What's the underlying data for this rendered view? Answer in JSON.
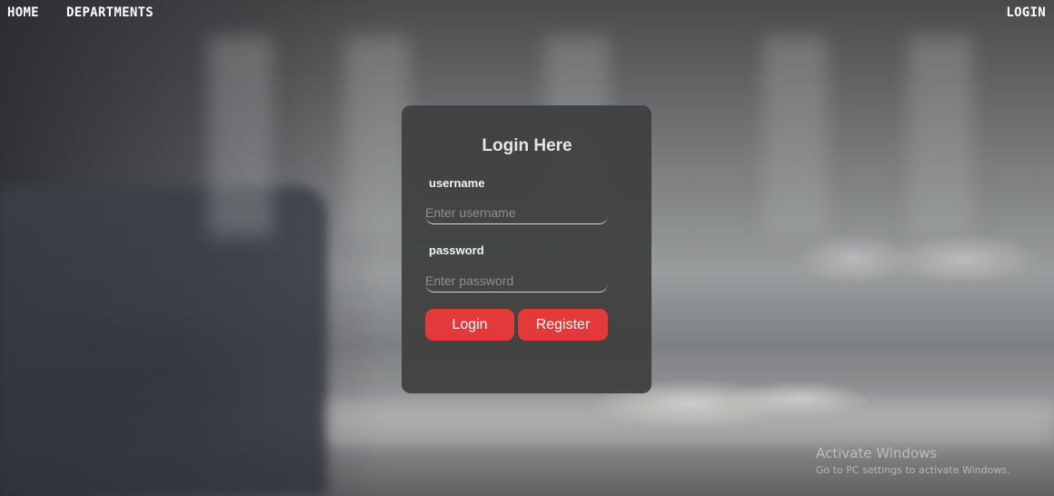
{
  "nav": {
    "home": "HOME",
    "departments": "DEPARTMENTS",
    "login": "LOGIN"
  },
  "login_form": {
    "title": "Login Here",
    "username_label": "username",
    "username_placeholder": "Enter username",
    "username_value": "",
    "password_label": "password",
    "password_placeholder": "Enter password",
    "password_value": "",
    "login_button": "Login",
    "register_button": "Register"
  },
  "watermark": {
    "title": "Activate Windows",
    "subtitle": "Go to PC settings to activate Windows."
  },
  "colors": {
    "accent": "#e23a3a",
    "card_background": "#3e3e3e",
    "nav_text": "#ffffff"
  }
}
